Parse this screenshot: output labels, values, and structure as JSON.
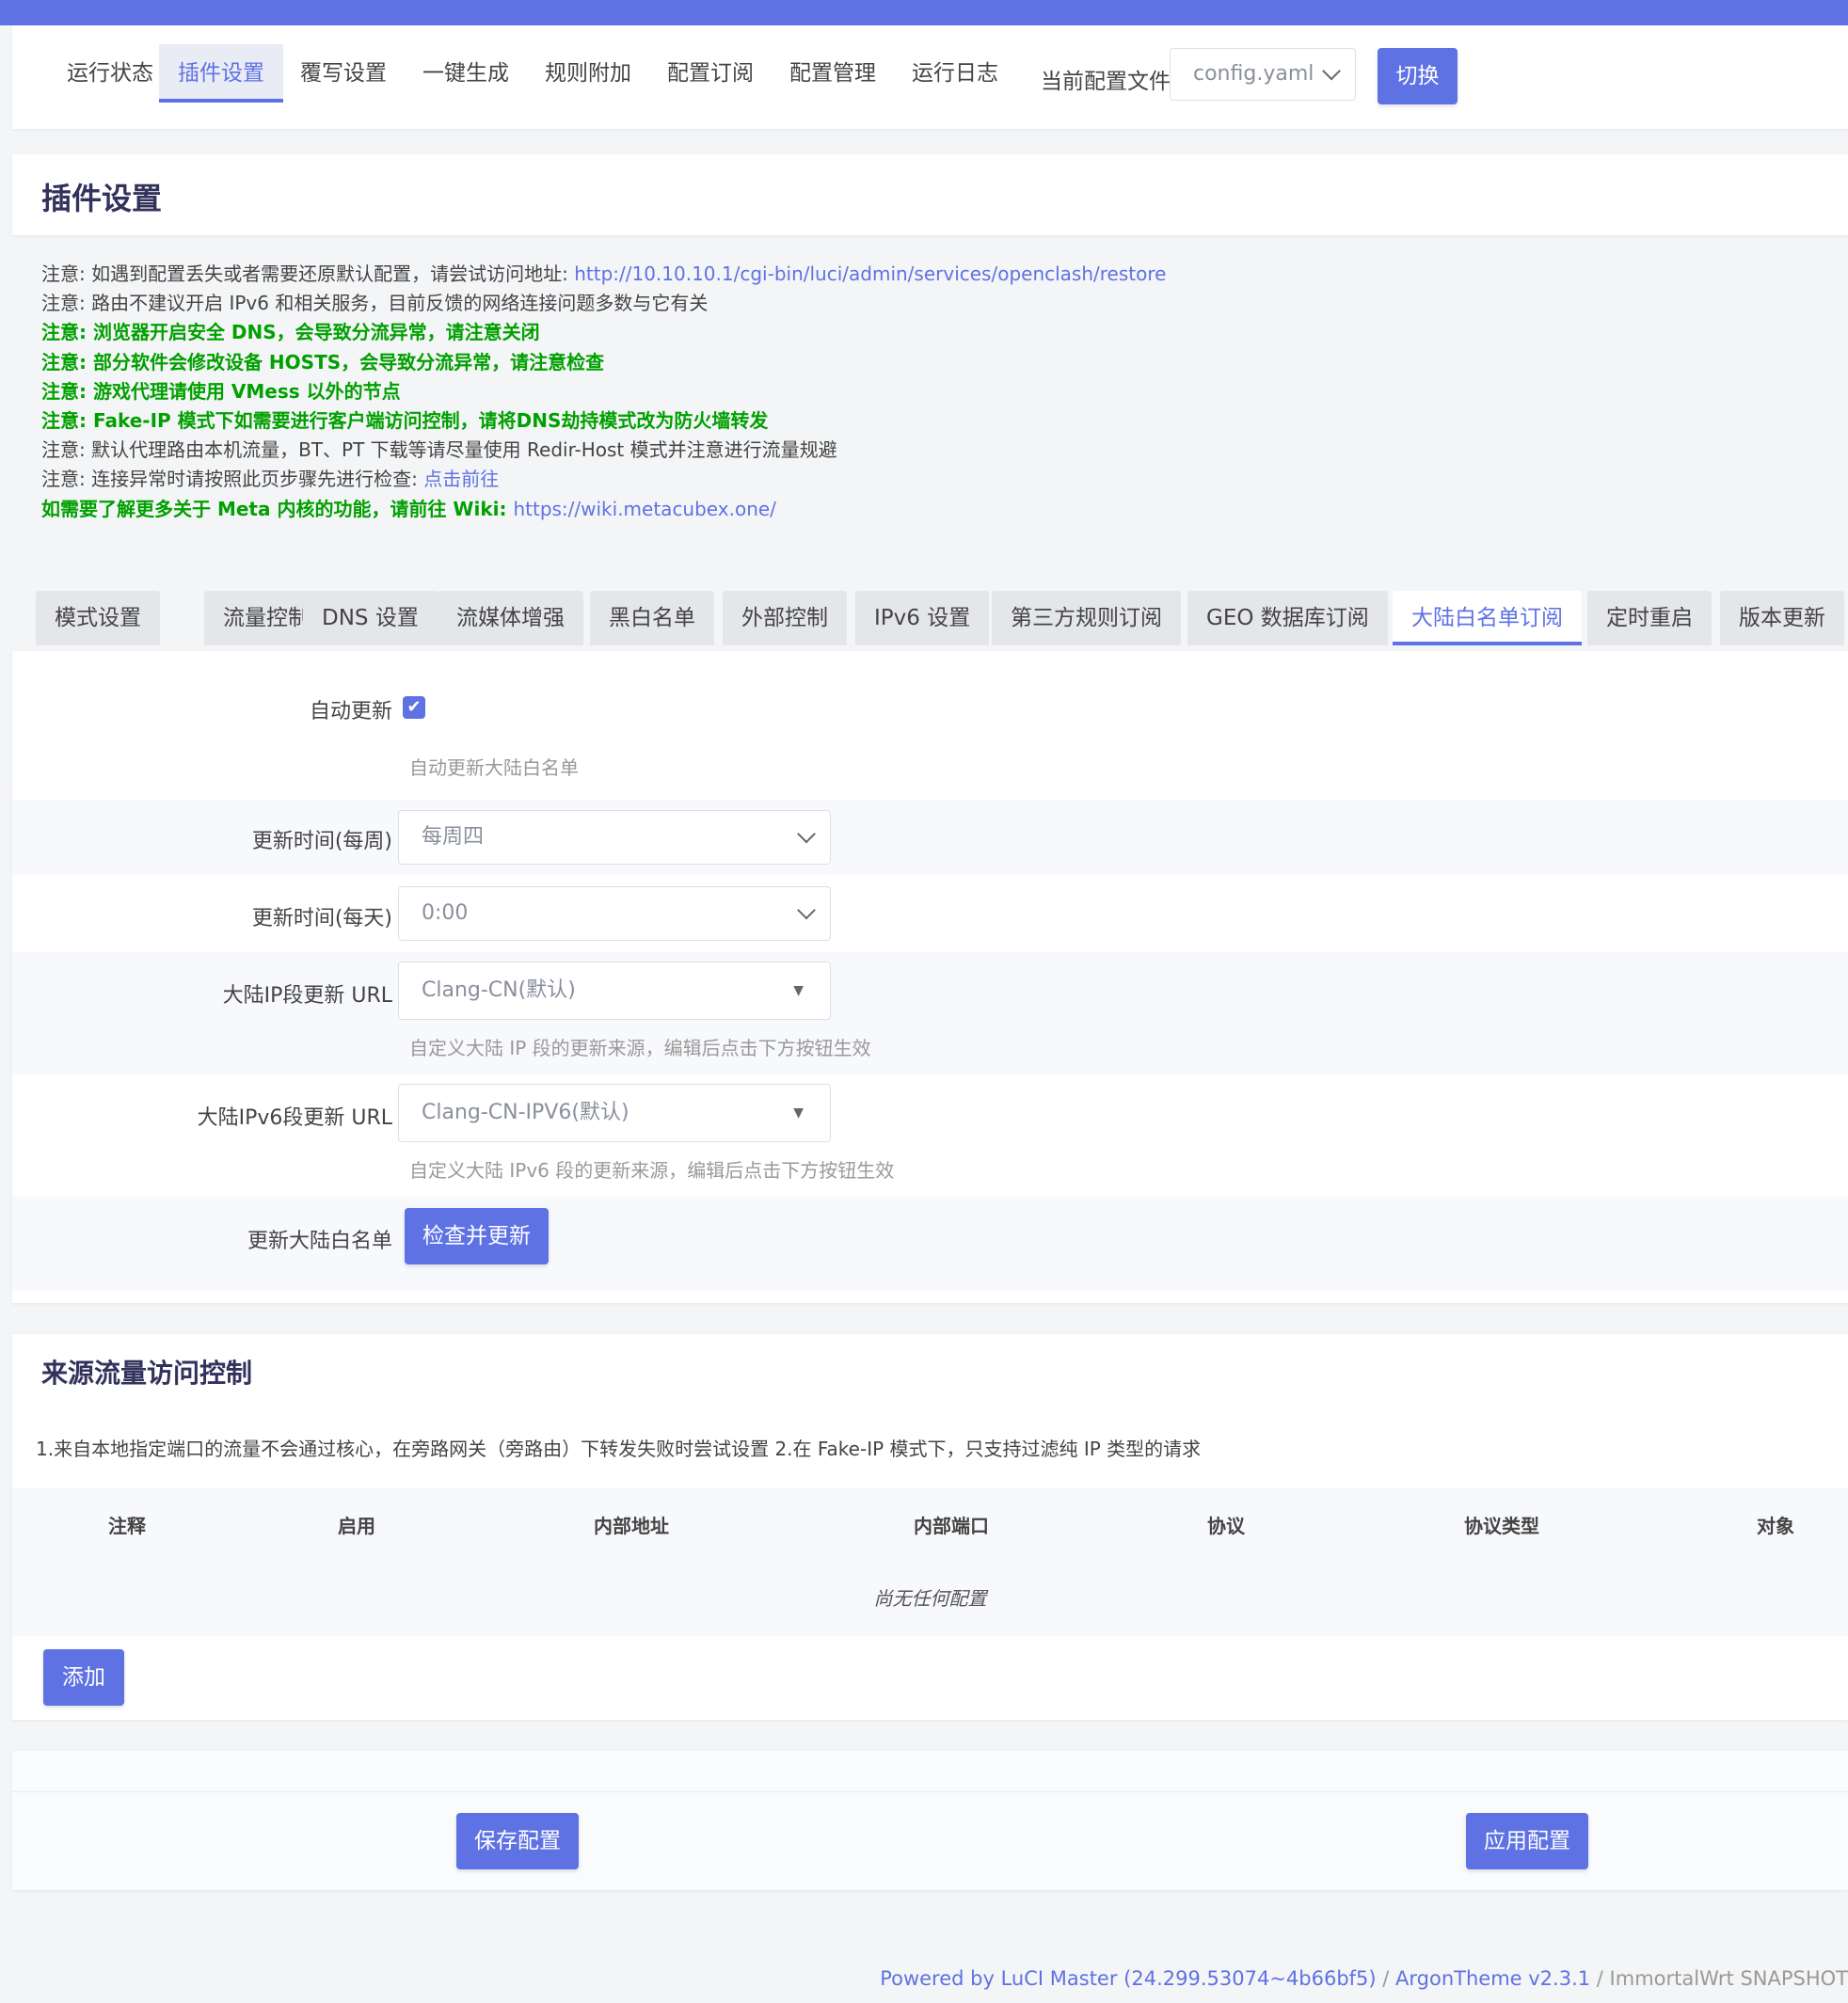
{
  "nav": {
    "tabs": [
      "运行状态",
      "插件设置",
      "覆写设置",
      "一键生成",
      "规则附加",
      "配置订阅",
      "配置管理",
      "运行日志"
    ],
    "active_tab": "插件设置",
    "config_label": "当前配置文件:",
    "config_value": "config.yaml",
    "switch_button": "切换"
  },
  "page_title": "插件设置",
  "notes": [
    {
      "prefix": "注意: 如遇到配置丢失或者需要还原默认配置，请尝试访问地址: ",
      "link": "http://10.10.10.1/cgi-bin/luci/admin/services/openclash/restore"
    },
    {
      "text": "注意: 路由不建议开启 IPv6 和相关服务，目前反馈的网络连接问题多数与它有关"
    },
    {
      "text": "注意: 浏览器开启安全 DNS，会导致分流异常，请注意关闭",
      "highlight": true
    },
    {
      "text": "注意: 部分软件会修改设备 HOSTS，会导致分流异常，请注意检查",
      "highlight": true
    },
    {
      "text": "注意: 游戏代理请使用 VMess 以外的节点",
      "highlight": true
    },
    {
      "text": "注意: Fake-IP 模式下如需要进行客户端访问控制，请将DNS劫持模式改为防火墙转发",
      "highlight": true
    },
    {
      "text": "注意: 默认代理路由本机流量，BT、PT 下载等请尽量使用 Redir-Host 模式并注意进行流量规避"
    },
    {
      "prefix": "注意: 连接异常时请按照此页步骤先进行检查: ",
      "link": "点击前往"
    },
    {
      "prefix": "如需要了解更多关于 Meta 内核的功能，请前往 Wiki: ",
      "link": "https://wiki.metacubex.one/",
      "highlight": true
    }
  ],
  "subtabs": [
    "模式设置",
    "流量控制",
    "DNS 设置",
    "流媒体增强",
    "黑白名单",
    "外部控制",
    "IPv6 设置",
    "第三方规则订阅",
    "GEO 数据库订阅",
    "大陆白名单订阅",
    "定时重启",
    "版本更新"
  ],
  "active_subtab": "大陆白名单订阅",
  "form": {
    "auto_update": {
      "label": "自动更新",
      "checked": true,
      "description": "自动更新大陆白名单"
    },
    "update_week": {
      "label": "更新时间(每周)",
      "value": "每周四"
    },
    "update_day": {
      "label": "更新时间(每天)",
      "value": "0:00"
    },
    "ip_url": {
      "label": "大陆IP段更新 URL",
      "value": "Clang-CN(默认)",
      "description": "自定义大陆 IP 段的更新来源，编辑后点击下方按钮生效"
    },
    "ipv6_url": {
      "label": "大陆IPv6段更新 URL",
      "value": "Clang-CN-IPV6(默认)",
      "description": "自定义大陆 IPv6 段的更新来源，编辑后点击下方按钮生效"
    },
    "update_now": {
      "label": "更新大陆白名单",
      "button": "检查并更新"
    }
  },
  "source_control": {
    "title": "来源流量访问控制",
    "description": "1.来自本地指定端口的流量不会通过核心，在旁路网关（旁路由）下转发失败时尝试设置 2.在 Fake-IP 模式下，只支持过滤纯 IP 类型的请求",
    "columns": [
      "注释",
      "启用",
      "内部地址",
      "内部端口",
      "协议",
      "协议类型",
      "对象"
    ],
    "empty_text": "尚无任何配置",
    "add_button": "添加"
  },
  "actions": {
    "save": "保存配置",
    "apply": "应用配置"
  },
  "footer": {
    "luci": "Powered by LuCI Master (24.299.53074~4b66bf5)",
    "sep": " / ",
    "theme": "ArgonTheme v2.3.1",
    "os": " / ImmortalWrt SNAPSHOT"
  }
}
